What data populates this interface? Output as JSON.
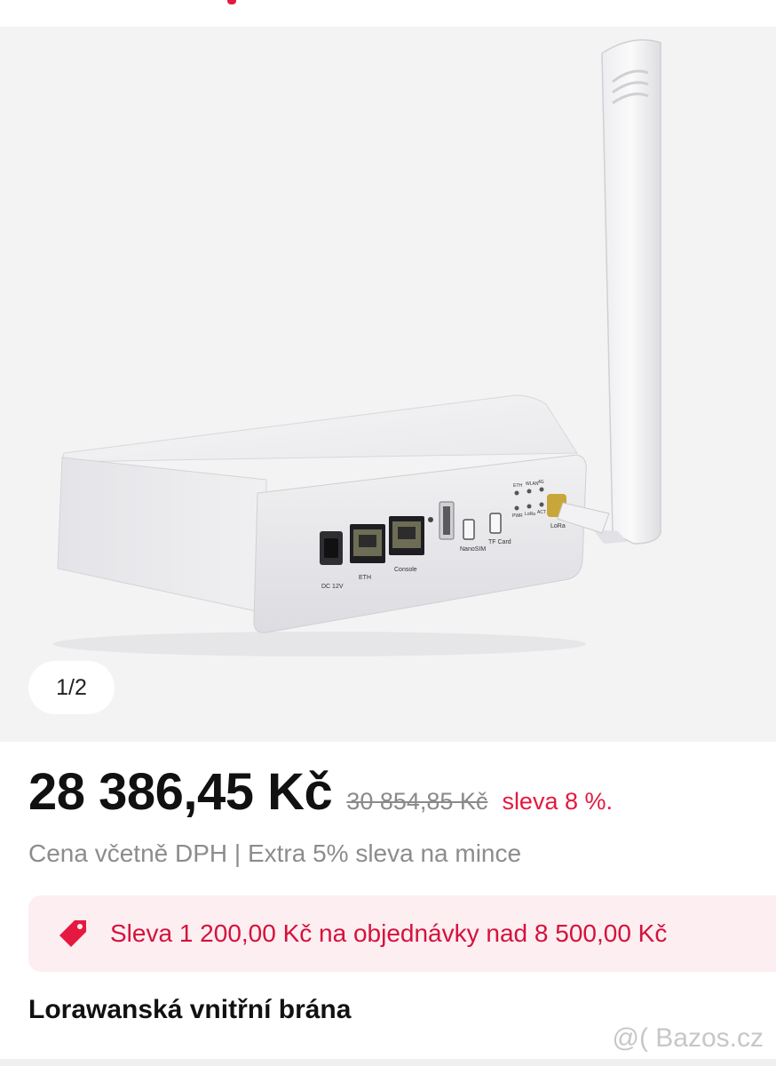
{
  "colors": {
    "accent": "#e5193f",
    "promo_bg": "#fdeef1",
    "gallery_bg": "#f3f3f3",
    "muted": "#8c8c8c"
  },
  "gallery": {
    "counter": "1/2",
    "device_labels": {
      "dc": "DC 12V",
      "eth": "ETH",
      "console": "Console",
      "nano_sim": "NanoSIM",
      "tf_card": "TF Card",
      "lora": "LoRa",
      "leds_top": [
        "ETH",
        "WLAN",
        "4G"
      ],
      "leds_bottom": [
        "PWR",
        "LoRa",
        "ACT"
      ]
    }
  },
  "pricing": {
    "price": "28 386,45 Kč",
    "old_price": "30 854,85 Kč",
    "discount": "sleva 8 %.",
    "vat_note": "Cena včetně DPH | Extra 5% sleva na mince"
  },
  "promo": {
    "icon": "price-tag-icon",
    "text": "Sleva 1 200,00 Kč na objednávky nad 8 500,00 Kč"
  },
  "product": {
    "title": "Lorawanská vnitřní brána"
  },
  "watermark": "@( Bazos.cz"
}
